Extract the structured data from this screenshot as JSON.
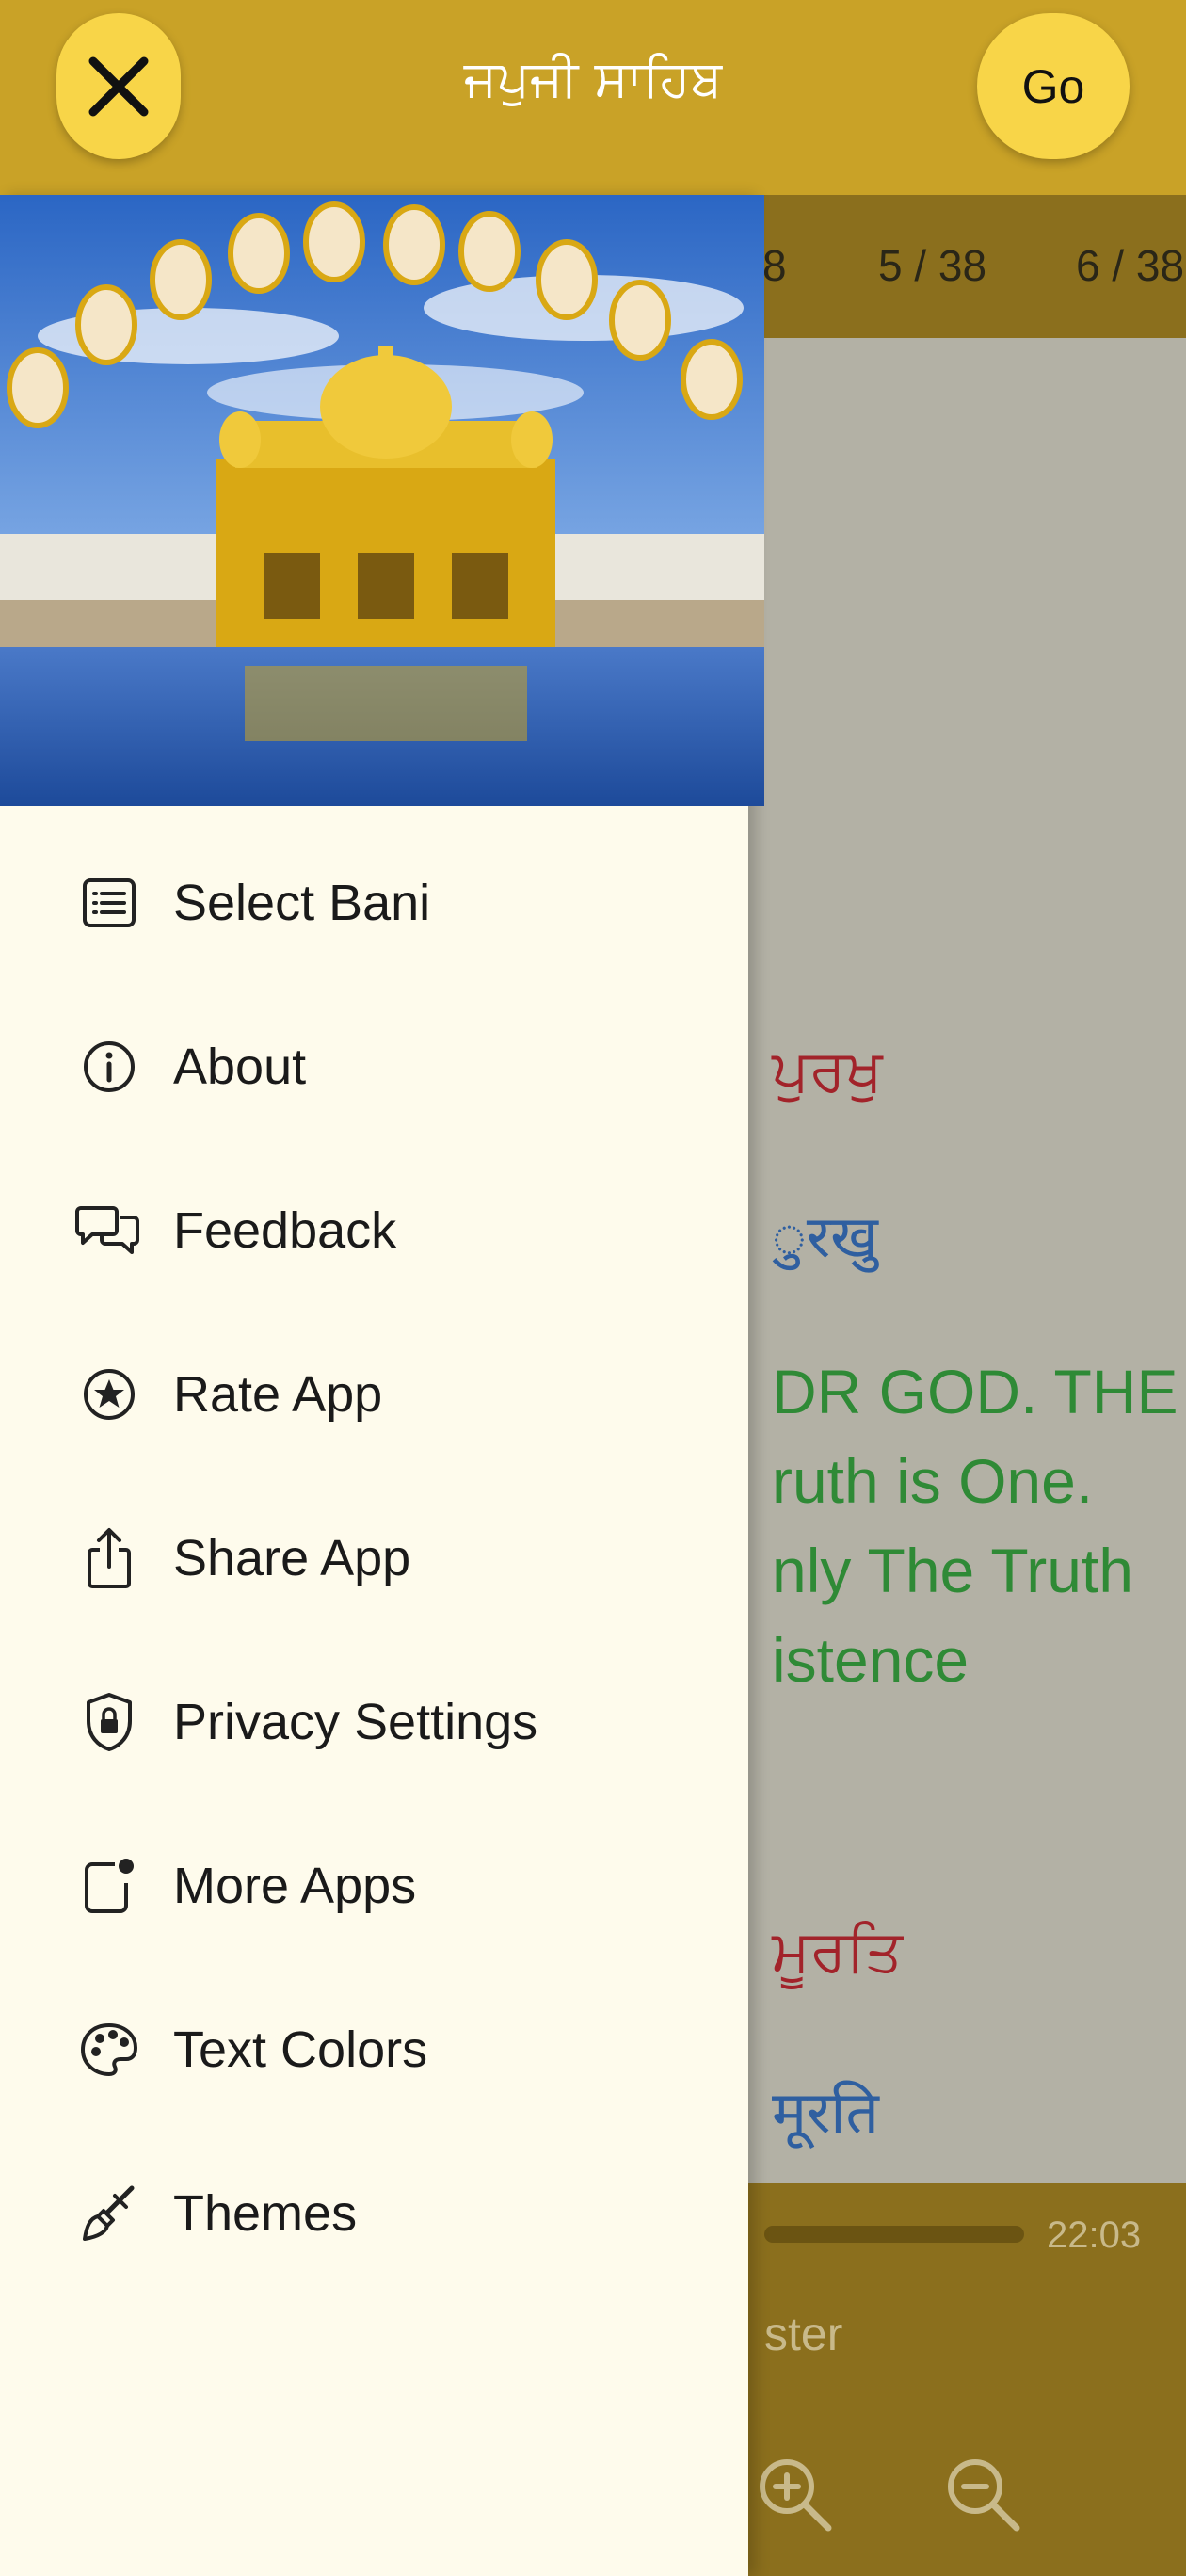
{
  "header": {
    "title": "ਜਪੁਜੀ ਸਾਹਿਬ",
    "close_icon": "close-icon",
    "go_label": "Go"
  },
  "background": {
    "page_tabs": [
      "8",
      "5 / 38",
      "6 / 38"
    ],
    "lines": [
      {
        "text": "ਪੁਰਖੁ",
        "color": "#a2232a"
      },
      {
        "text": "ुरखु",
        "color": "#2f5fa0"
      },
      {
        "text": "DR GOD. THE",
        "color": "#2f8a36"
      },
      {
        "text": "ruth is One.",
        "color": "#2f8a36"
      },
      {
        "text": "nly The Truth",
        "color": "#2f8a36"
      },
      {
        "text": "istence",
        "color": "#2f8a36"
      },
      {
        "text": "ਮੂਰਤਿ",
        "color": "#a2232a"
      },
      {
        "text": "मूरति",
        "color": "#2f5fa0"
      }
    ],
    "time": "22:03",
    "partial_label": "ster",
    "zoom_in_icon": "zoom-in-icon",
    "zoom_out_icon": "zoom-out-icon"
  },
  "drawer": {
    "image": "golden-temple-with-gurus",
    "items": [
      {
        "label": "Select Bani",
        "icon": "list-icon"
      },
      {
        "label": "About",
        "icon": "info-icon"
      },
      {
        "label": "Feedback",
        "icon": "chat-bubbles-icon"
      },
      {
        "label": "Rate App",
        "icon": "star-circle-icon"
      },
      {
        "label": "Share App",
        "icon": "share-icon"
      },
      {
        "label": "Privacy Settings",
        "icon": "shield-lock-icon"
      },
      {
        "label": "More Apps",
        "icon": "app-badge-icon"
      },
      {
        "label": "Text Colors",
        "icon": "palette-icon"
      },
      {
        "label": "Themes",
        "icon": "paintbrush-icon"
      }
    ]
  },
  "colors": {
    "topbar": "#c9a227",
    "button": "#f8d548",
    "drawer": "#fefbec",
    "overlay_bar": "#8b6f1d"
  }
}
